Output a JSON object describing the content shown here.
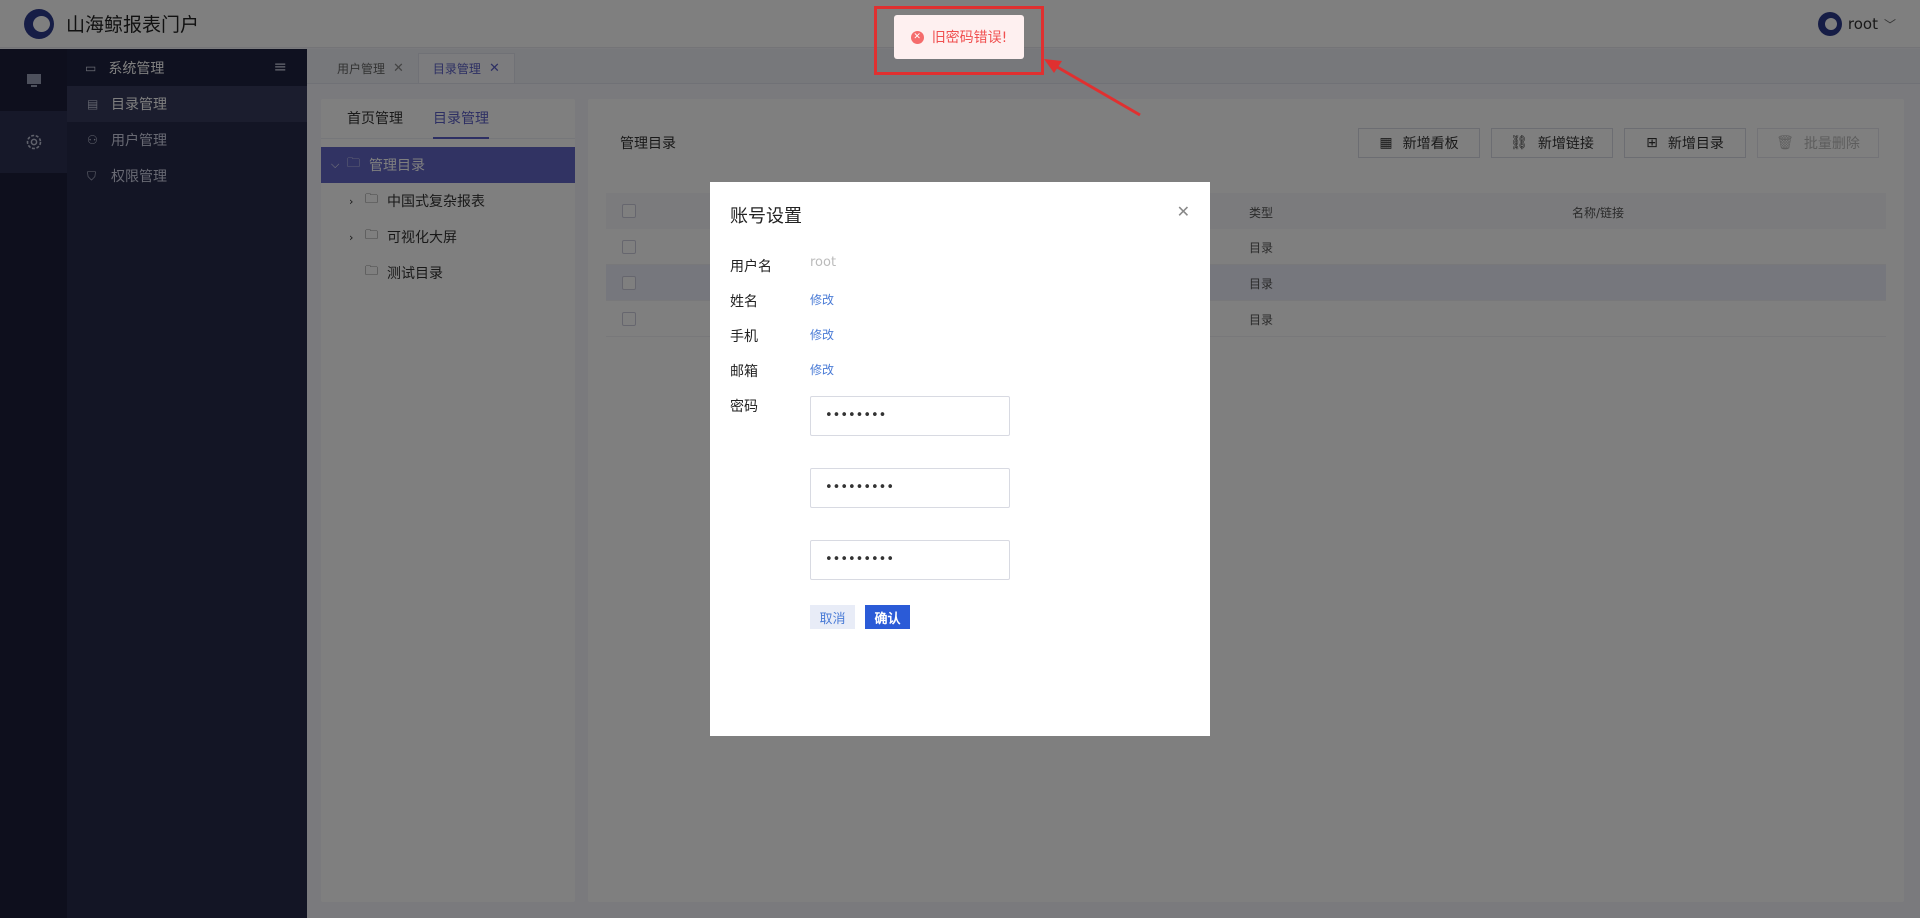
{
  "header": {
    "app_title": "山海鲸报表门户",
    "user_name": "root"
  },
  "sidebar": {
    "group_label": "系统管理",
    "items": [
      {
        "label": "目录管理",
        "icon": "catalog-icon",
        "active": true
      },
      {
        "label": "用户管理",
        "icon": "users-icon",
        "active": false
      },
      {
        "label": "权限管理",
        "icon": "shield-icon",
        "active": false
      }
    ]
  },
  "tabs": [
    {
      "label": "用户管理",
      "active": false
    },
    {
      "label": "目录管理",
      "active": true
    }
  ],
  "left_panel": {
    "tabs": [
      {
        "label": "首页管理",
        "active": false
      },
      {
        "label": "目录管理",
        "active": true
      }
    ],
    "tree": {
      "root": "管理目录",
      "children": [
        "中国式复杂报表",
        "可视化大屏",
        "测试目录"
      ]
    }
  },
  "main": {
    "title": "管理目录",
    "buttons": {
      "add_board": "新增看板",
      "add_link": "新增链接",
      "add_dir": "新增目录",
      "batch_delete": "批量删除"
    },
    "table": {
      "headers": {
        "type": "类型",
        "name": "名称/链接"
      },
      "rows": [
        {
          "type": "目录",
          "name": ""
        },
        {
          "type": "目录",
          "name": ""
        },
        {
          "type": "目录",
          "name": ""
        }
      ]
    }
  },
  "modal": {
    "title": "账号设置",
    "fields": {
      "username_label": "用户名",
      "username_value": "root",
      "name_label": "姓名",
      "name_action": "修改",
      "phone_label": "手机",
      "phone_action": "修改",
      "email_label": "邮箱",
      "email_action": "修改",
      "password_label": "密码"
    },
    "password_inputs": [
      "••••••••",
      "•••••••••",
      "•••••••••"
    ],
    "cancel_label": "取消",
    "confirm_label": "确认"
  },
  "toast": {
    "message": "旧密码错误!"
  },
  "colors": {
    "accent": "#5b5fc7",
    "primary_button": "#2b5bd7",
    "error": "#f05050",
    "highlight_frame": "#e03030"
  }
}
